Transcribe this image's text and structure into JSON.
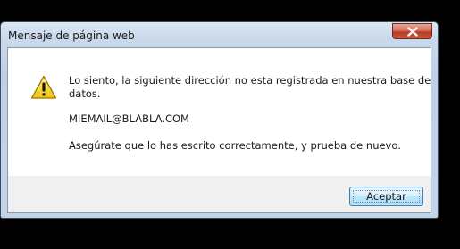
{
  "dialog": {
    "title": "Mensaje de página web",
    "close_icon": "close-icon",
    "warning_icon": "warning-icon",
    "message_line1": "Lo siento, la siguiente  dirección  no esta registrada en nuestra base de",
    "message_line2": "datos.",
    "email": "MIEMAIL@BLABLA.COM",
    "hint": "Asegúrate que lo has escrito correctamente, y prueba de nuevo.",
    "ok_label": "Aceptar"
  }
}
